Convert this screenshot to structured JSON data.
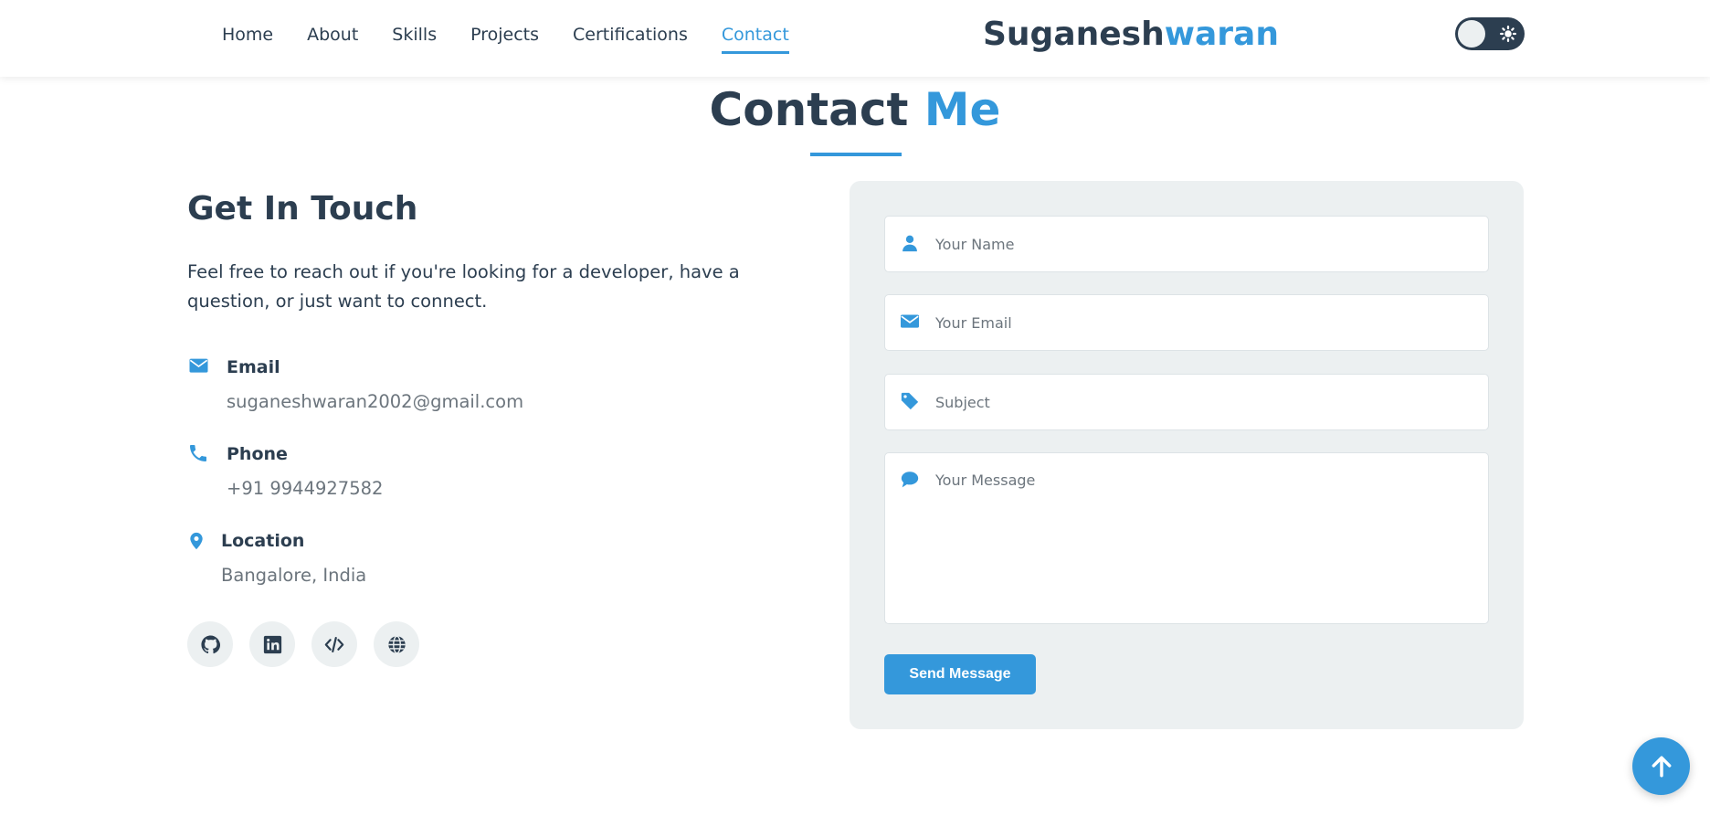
{
  "nav": {
    "links": [
      "Home",
      "About",
      "Skills",
      "Projects",
      "Certifications",
      "Contact"
    ],
    "active": "Contact",
    "brand_main": "Suganesh",
    "brand_accent": "waran"
  },
  "section": {
    "title_main": "Contact ",
    "title_accent": "Me"
  },
  "touch": {
    "heading": "Get In Touch",
    "description": "Feel free to reach out if you're looking for a developer, have a question, or just want to connect.",
    "email_label": "Email",
    "email_value": "suganeshwaran2002@gmail.com",
    "phone_label": "Phone",
    "phone_value": "+91 9944927582",
    "location_label": "Location",
    "location_value": "Bangalore, India",
    "socials": [
      "github-icon",
      "linkedin-icon",
      "code-icon",
      "globe-icon"
    ]
  },
  "form": {
    "name_placeholder": "Your Name",
    "email_placeholder": "Your Email",
    "subject_placeholder": "Subject",
    "message_placeholder": "Your Message",
    "send_label": "Send Message"
  },
  "colors": {
    "accent": "#3498db",
    "dark": "#2c3e50",
    "muted": "#6c757d",
    "card_bg": "#ecf0f1"
  }
}
